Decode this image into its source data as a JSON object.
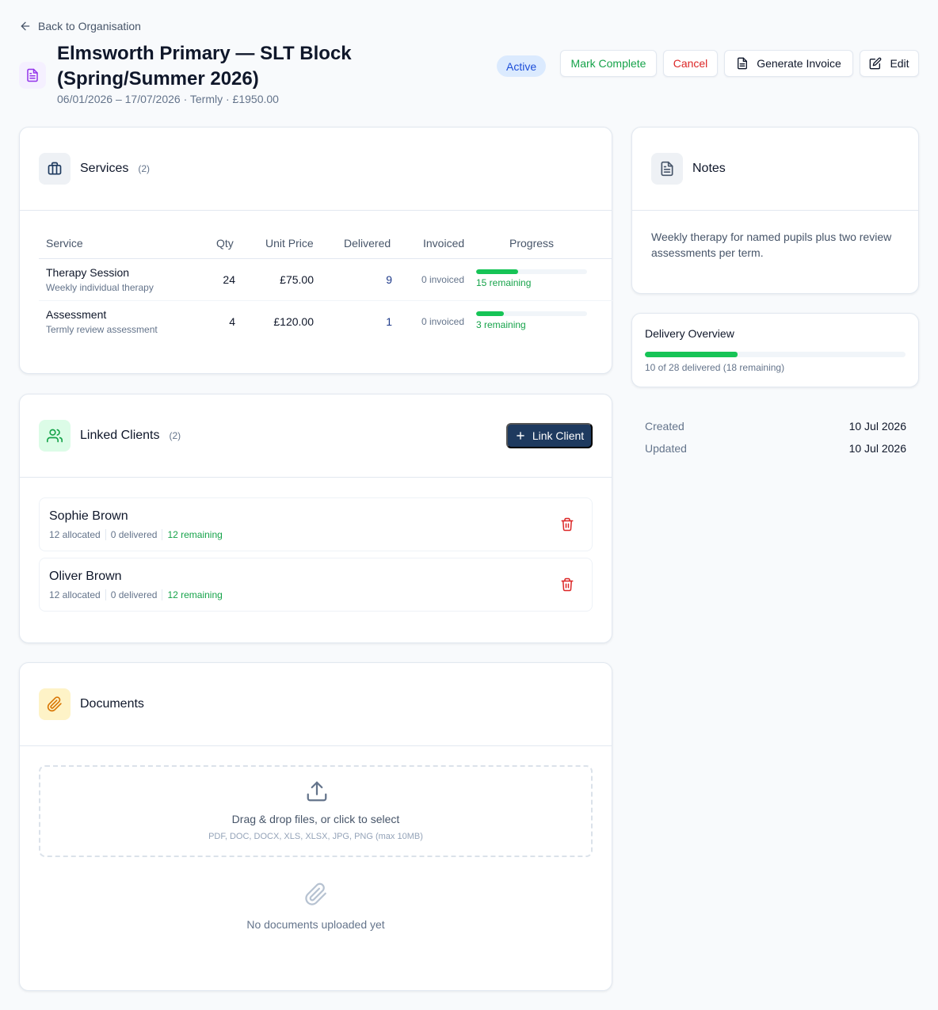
{
  "header": {
    "back_label": "Back to Organisation",
    "title": "Elmsworth Primary — SLT Block (Spring/Summer 2026)",
    "subtitle": "06/01/2026 – 17/07/2026 · Termly · £1950.00",
    "status": "Active",
    "actions": {
      "complete": "Mark Complete",
      "cancel": "Cancel",
      "invoice": "Generate Invoice",
      "edit": "Edit"
    }
  },
  "services": {
    "title": "Services",
    "count": "(2)",
    "columns": [
      "Service",
      "Qty",
      "Unit Price",
      "Delivered",
      "Invoiced",
      "Progress"
    ],
    "rows": [
      {
        "name": "Therapy Session",
        "desc": "Weekly individual therapy",
        "qty": "24",
        "unit_price": "£75.00",
        "delivered": "9",
        "invoiced": "0 invoiced",
        "progress": 0.375,
        "remaining": "15 remaining"
      },
      {
        "name": "Assessment",
        "desc": "Termly review assessment",
        "qty": "4",
        "unit_price": "£120.00",
        "delivered": "1",
        "invoiced": "0 invoiced",
        "progress": 0.25,
        "remaining": "3 remaining"
      }
    ]
  },
  "clients": {
    "title": "Linked Clients",
    "count": "(2)",
    "link_button": "Link Client",
    "items": [
      {
        "name": "Sophie Brown",
        "allocated": "12 allocated",
        "delivered": "0 delivered",
        "remaining": "12 remaining"
      },
      {
        "name": "Oliver Brown",
        "allocated": "12 allocated",
        "delivered": "0 delivered",
        "remaining": "12 remaining"
      }
    ]
  },
  "documents": {
    "title": "Documents",
    "drop_text": "Drag & drop files, or click to select",
    "drop_sub": "PDF, DOC, DOCX, XLS, XLSX, JPG, PNG (max 10MB)",
    "empty": "No documents uploaded yet"
  },
  "notes": {
    "title": "Notes",
    "text": "Weekly therapy for named pupils plus two review assessments per term."
  },
  "overview": {
    "title": "Delivery Overview",
    "progress": 0.357,
    "text": "10 of 28 delivered (18 remaining)"
  },
  "meta": {
    "created_label": "Created",
    "created": "10 Jul 2026",
    "updated_label": "Updated",
    "updated": "10 Jul 2026"
  },
  "colors": {
    "accent_dark": "#1e3a5f",
    "success": "#16a34a",
    "danger": "#dc2626",
    "progress": "#16c456",
    "badge_bg": "#dbeafe"
  },
  "icons": {
    "back": "arrow-left-icon",
    "title": "document-icon",
    "services": "briefcase-icon",
    "clients": "users-icon",
    "documents": "paperclip-icon",
    "notes": "document-icon",
    "delete": "trash-icon",
    "upload": "upload-icon"
  }
}
